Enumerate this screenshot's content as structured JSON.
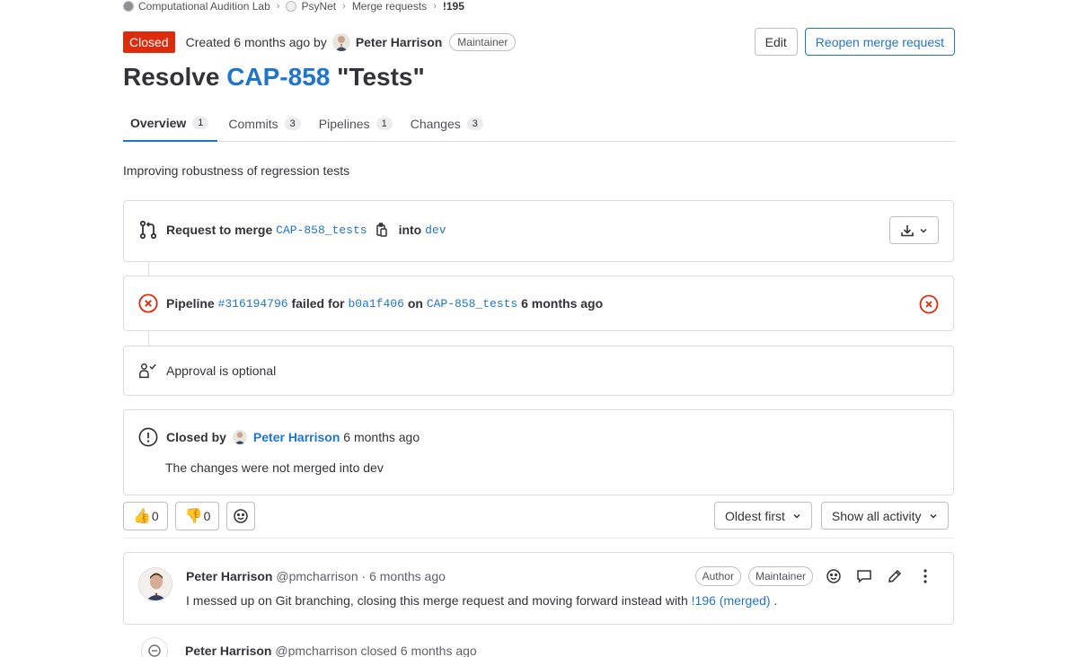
{
  "breadcrumb": {
    "group": "Computational Audition Lab",
    "project": "PsyNet",
    "section": "Merge requests",
    "current": "!195"
  },
  "header": {
    "status": "Closed",
    "created_text": "Created 6 months ago by",
    "author": "Peter Harrison",
    "role": "Maintainer",
    "edit_label": "Edit",
    "reopen_label": "Reopen merge request"
  },
  "title": {
    "prefix": "Resolve",
    "issue": "CAP-858",
    "suffix": "\"Tests\""
  },
  "tabs": [
    {
      "label": "Overview",
      "count": "1"
    },
    {
      "label": "Commits",
      "count": "3"
    },
    {
      "label": "Pipelines",
      "count": "1"
    },
    {
      "label": "Changes",
      "count": "3"
    }
  ],
  "description": "Improving robustness of regression tests",
  "merge_widget": {
    "request_label": "Request to merge",
    "source_branch": "CAP-858_tests",
    "into_label": "into",
    "target_branch": "dev"
  },
  "pipeline_widget": {
    "label": "Pipeline",
    "pipeline_id": "#316194796",
    "failed_for": "failed for",
    "commit": "b0a1f406",
    "on": "on",
    "branch": "CAP-858_tests",
    "time": "6 months ago",
    "status_color": "#dd2b0e"
  },
  "approval_widget": {
    "text": "Approval is optional"
  },
  "closed_widget": {
    "closed_by": "Closed by",
    "author": "Peter Harrison",
    "time": "6 months ago",
    "message": "The changes were not merged into dev"
  },
  "reactions": {
    "thumbs_up": "👍",
    "thumbs_up_count": "0",
    "thumbs_down": "👎",
    "thumbs_down_count": "0"
  },
  "sorting": {
    "order": "Oldest first",
    "filter": "Show all activity"
  },
  "note": {
    "author": "Peter Harrison",
    "handle": "@pmcharrison",
    "dot": "·",
    "time": "6 months ago",
    "badge_author": "Author",
    "badge_role": "Maintainer",
    "body_text": "I messed up on Git branching, closing this merge request and moving forward instead with",
    "body_link": "!196 (merged)",
    "body_end": "."
  },
  "system_note": {
    "author": "Peter Harrison",
    "text": "@pmcharrison closed 6 months ago"
  },
  "colors": {
    "accent": "#1f75cb",
    "danger": "#dd2b0e",
    "border": "#dcdcde"
  }
}
